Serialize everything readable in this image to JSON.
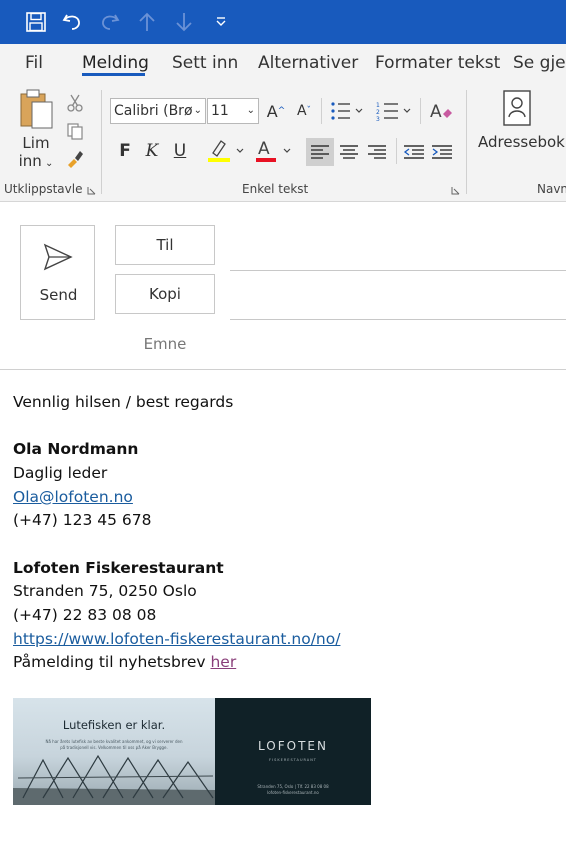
{
  "colors": {
    "title_bar": "#185abd",
    "ribbon_bg": "#f3f3f3",
    "link": "#1a5c9e",
    "visited_link": "#8a3f7a",
    "highlight_yellow": "#ffff00",
    "font_color_red": "#e81123"
  },
  "quick_access": {
    "icons": [
      "save-icon",
      "undo-icon",
      "redo-icon",
      "arrow-up-icon",
      "arrow-down-icon",
      "customize-qat-icon"
    ]
  },
  "tabs": [
    {
      "label": "Fil"
    },
    {
      "label": "Melding",
      "active": true
    },
    {
      "label": "Sett inn"
    },
    {
      "label": "Alternativer"
    },
    {
      "label": "Formater tekst"
    },
    {
      "label": "Se gjen"
    }
  ],
  "ribbon": {
    "clipboard": {
      "paste_label_1": "Lim",
      "paste_label_2": "inn",
      "group_label": "Utklippstavle"
    },
    "font": {
      "font_name": "Calibri (Brø",
      "font_size": "11",
      "bold": "F",
      "italic": "K",
      "underline": "U",
      "group_label": "Enkel tekst"
    },
    "names": {
      "address_book_label": "Adressebok K",
      "group_label": "Navn"
    }
  },
  "compose": {
    "send_label": "Send",
    "to_label": "Til",
    "cc_label": "Kopi",
    "subject_label": "Emne",
    "to_value": "",
    "cc_value": ""
  },
  "signature": {
    "greeting": "Vennlig hilsen / best regards",
    "name": "Ola Nordmann",
    "title": "Daglig leder",
    "email": "Ola@lofoten.no",
    "phone": "(+47) 123 45 678",
    "company": "Lofoten Fiskerestaurant",
    "address": "Stranden 75, 0250 Oslo",
    "company_phone": "(+47) 22 83 08 08",
    "website": "https://www.lofoten-fiskerestaurant.no/no/",
    "newsletter_text": "Påmelding til nyhetsbrev ",
    "newsletter_link": "her"
  },
  "banner": {
    "headline": "Lutefisken er klar.",
    "body": "Nå har årets lutefisk av beste kvalitet ankommet, og vi serverer den på tradisjonell vis. Velkommen til oss på Aker Brygge.",
    "logo": "LOFOTEN",
    "logo_sub": "FISKERESTAURANT",
    "address_line": "Stranden 75, Oslo | Tlf. 22 83 08 08",
    "web_line": "lofoten-fiskerestaurant.no"
  }
}
